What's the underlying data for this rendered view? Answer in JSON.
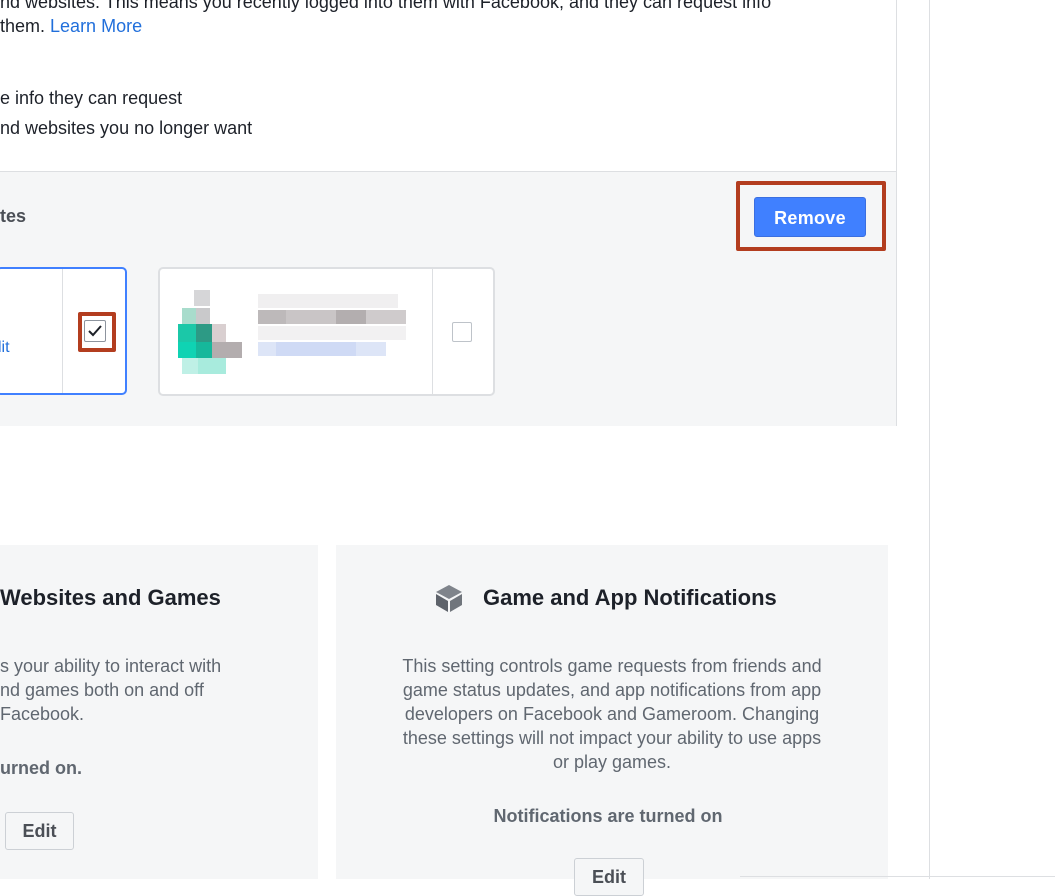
{
  "intro": {
    "line1": "nd websites. This means you recently logged into them with Facebook, and they can request info",
    "line2_prefix": " them. ",
    "learn_more": "Learn More"
  },
  "bullets": [
    "e info they can request",
    "nd websites you no longer want"
  ],
  "active_section": {
    "heading": "tes",
    "remove_label": "Remove",
    "card1_edit": "lit"
  },
  "left_card": {
    "title": "Websites and Games",
    "body": [
      "s your ability to interact with",
      "nd games both on and off",
      "Facebook."
    ],
    "status": "urned on.",
    "edit_label": "Edit"
  },
  "right_card": {
    "title": "Game and App Notifications",
    "icon": "cube-icon",
    "body": [
      "This setting controls game requests from friends and",
      "game status updates, and app notifications from app",
      "developers on Facebook and Gameroom. Changing",
      "these settings will not impact your ability to use apps",
      "or play games."
    ],
    "status": "Notifications are turned on",
    "edit_label": "Edit"
  },
  "colors": {
    "accent": "#4080ff",
    "link": "#216fdb",
    "highlight": "#b33d1f"
  }
}
